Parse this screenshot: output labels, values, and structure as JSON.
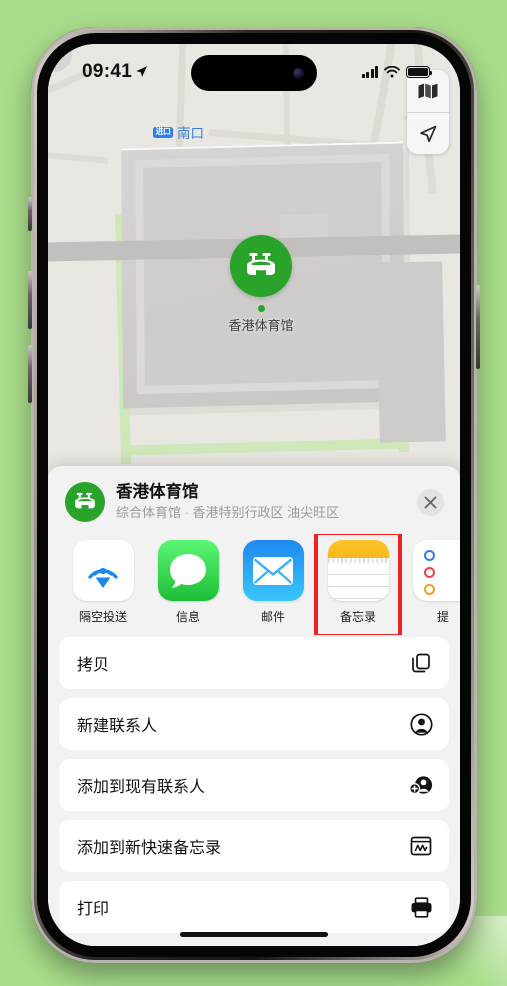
{
  "background": {
    "color": "#a9dd8b"
  },
  "status_bar": {
    "time": "09:41",
    "location_arrow": "location-arrow-icon",
    "signal": "cellular-bars-icon",
    "wifi": "wifi-icon",
    "battery": "battery-icon"
  },
  "map": {
    "transit_label": {
      "badge": "进口",
      "text": "南口"
    },
    "poi": {
      "label": "香港体育馆",
      "pin_color": "#2aa32a",
      "icon": "stadium-icon"
    },
    "controls": [
      {
        "name": "map-layers-button",
        "icon": "folded-map-icon"
      },
      {
        "name": "locate-me-button",
        "icon": "navigation-arrow-icon"
      }
    ]
  },
  "share_sheet": {
    "title": "香港体育馆",
    "subtitle": "综合体育馆 · 香港特别行政区 油尖旺区",
    "close_label": "✕",
    "apps": [
      {
        "label": "隔空投送",
        "icon": "airdrop-icon",
        "highlighted": false
      },
      {
        "label": "信息",
        "icon": "messages-icon",
        "highlighted": false
      },
      {
        "label": "邮件",
        "icon": "mail-icon",
        "highlighted": false
      },
      {
        "label": "备忘录",
        "icon": "notes-icon",
        "highlighted": true
      },
      {
        "label": "提",
        "icon": "reminders-icon",
        "highlighted": false
      }
    ],
    "actions": [
      {
        "label": "拷贝",
        "icon": "copy-icon"
      },
      {
        "label": "新建联系人",
        "icon": "person-circle-icon"
      },
      {
        "label": "添加到现有联系人",
        "icon": "person-add-icon"
      },
      {
        "label": "添加到新快速备忘录",
        "icon": "quick-note-icon"
      },
      {
        "label": "打印",
        "icon": "printer-icon"
      }
    ]
  },
  "highlight": {
    "color": "#ee2222"
  }
}
